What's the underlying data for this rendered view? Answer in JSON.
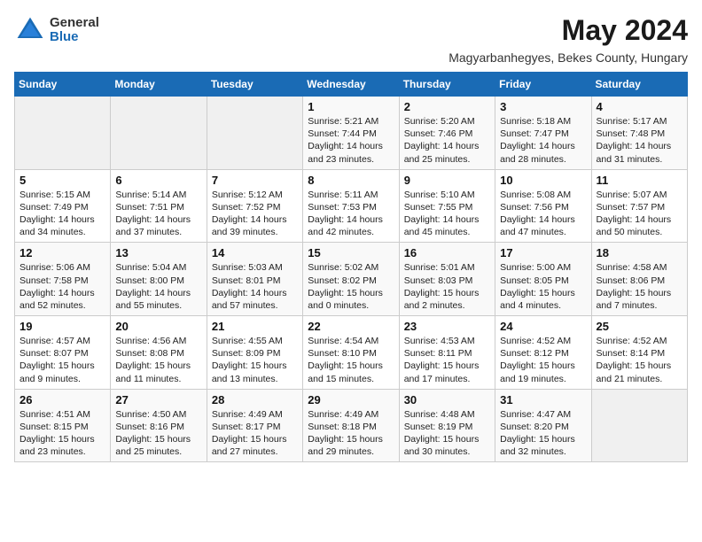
{
  "header": {
    "logo_general": "General",
    "logo_blue": "Blue",
    "month": "May 2024",
    "location": "Magyarbanhegyes, Bekes County, Hungary"
  },
  "weekdays": [
    "Sunday",
    "Monday",
    "Tuesday",
    "Wednesday",
    "Thursday",
    "Friday",
    "Saturday"
  ],
  "weeks": [
    [
      {
        "day": "",
        "info": ""
      },
      {
        "day": "",
        "info": ""
      },
      {
        "day": "",
        "info": ""
      },
      {
        "day": "1",
        "info": "Sunrise: 5:21 AM\nSunset: 7:44 PM\nDaylight: 14 hours\nand 23 minutes."
      },
      {
        "day": "2",
        "info": "Sunrise: 5:20 AM\nSunset: 7:46 PM\nDaylight: 14 hours\nand 25 minutes."
      },
      {
        "day": "3",
        "info": "Sunrise: 5:18 AM\nSunset: 7:47 PM\nDaylight: 14 hours\nand 28 minutes."
      },
      {
        "day": "4",
        "info": "Sunrise: 5:17 AM\nSunset: 7:48 PM\nDaylight: 14 hours\nand 31 minutes."
      }
    ],
    [
      {
        "day": "5",
        "info": "Sunrise: 5:15 AM\nSunset: 7:49 PM\nDaylight: 14 hours\nand 34 minutes."
      },
      {
        "day": "6",
        "info": "Sunrise: 5:14 AM\nSunset: 7:51 PM\nDaylight: 14 hours\nand 37 minutes."
      },
      {
        "day": "7",
        "info": "Sunrise: 5:12 AM\nSunset: 7:52 PM\nDaylight: 14 hours\nand 39 minutes."
      },
      {
        "day": "8",
        "info": "Sunrise: 5:11 AM\nSunset: 7:53 PM\nDaylight: 14 hours\nand 42 minutes."
      },
      {
        "day": "9",
        "info": "Sunrise: 5:10 AM\nSunset: 7:55 PM\nDaylight: 14 hours\nand 45 minutes."
      },
      {
        "day": "10",
        "info": "Sunrise: 5:08 AM\nSunset: 7:56 PM\nDaylight: 14 hours\nand 47 minutes."
      },
      {
        "day": "11",
        "info": "Sunrise: 5:07 AM\nSunset: 7:57 PM\nDaylight: 14 hours\nand 50 minutes."
      }
    ],
    [
      {
        "day": "12",
        "info": "Sunrise: 5:06 AM\nSunset: 7:58 PM\nDaylight: 14 hours\nand 52 minutes."
      },
      {
        "day": "13",
        "info": "Sunrise: 5:04 AM\nSunset: 8:00 PM\nDaylight: 14 hours\nand 55 minutes."
      },
      {
        "day": "14",
        "info": "Sunrise: 5:03 AM\nSunset: 8:01 PM\nDaylight: 14 hours\nand 57 minutes."
      },
      {
        "day": "15",
        "info": "Sunrise: 5:02 AM\nSunset: 8:02 PM\nDaylight: 15 hours\nand 0 minutes."
      },
      {
        "day": "16",
        "info": "Sunrise: 5:01 AM\nSunset: 8:03 PM\nDaylight: 15 hours\nand 2 minutes."
      },
      {
        "day": "17",
        "info": "Sunrise: 5:00 AM\nSunset: 8:05 PM\nDaylight: 15 hours\nand 4 minutes."
      },
      {
        "day": "18",
        "info": "Sunrise: 4:58 AM\nSunset: 8:06 PM\nDaylight: 15 hours\nand 7 minutes."
      }
    ],
    [
      {
        "day": "19",
        "info": "Sunrise: 4:57 AM\nSunset: 8:07 PM\nDaylight: 15 hours\nand 9 minutes."
      },
      {
        "day": "20",
        "info": "Sunrise: 4:56 AM\nSunset: 8:08 PM\nDaylight: 15 hours\nand 11 minutes."
      },
      {
        "day": "21",
        "info": "Sunrise: 4:55 AM\nSunset: 8:09 PM\nDaylight: 15 hours\nand 13 minutes."
      },
      {
        "day": "22",
        "info": "Sunrise: 4:54 AM\nSunset: 8:10 PM\nDaylight: 15 hours\nand 15 minutes."
      },
      {
        "day": "23",
        "info": "Sunrise: 4:53 AM\nSunset: 8:11 PM\nDaylight: 15 hours\nand 17 minutes."
      },
      {
        "day": "24",
        "info": "Sunrise: 4:52 AM\nSunset: 8:12 PM\nDaylight: 15 hours\nand 19 minutes."
      },
      {
        "day": "25",
        "info": "Sunrise: 4:52 AM\nSunset: 8:14 PM\nDaylight: 15 hours\nand 21 minutes."
      }
    ],
    [
      {
        "day": "26",
        "info": "Sunrise: 4:51 AM\nSunset: 8:15 PM\nDaylight: 15 hours\nand 23 minutes."
      },
      {
        "day": "27",
        "info": "Sunrise: 4:50 AM\nSunset: 8:16 PM\nDaylight: 15 hours\nand 25 minutes."
      },
      {
        "day": "28",
        "info": "Sunrise: 4:49 AM\nSunset: 8:17 PM\nDaylight: 15 hours\nand 27 minutes."
      },
      {
        "day": "29",
        "info": "Sunrise: 4:49 AM\nSunset: 8:18 PM\nDaylight: 15 hours\nand 29 minutes."
      },
      {
        "day": "30",
        "info": "Sunrise: 4:48 AM\nSunset: 8:19 PM\nDaylight: 15 hours\nand 30 minutes."
      },
      {
        "day": "31",
        "info": "Sunrise: 4:47 AM\nSunset: 8:20 PM\nDaylight: 15 hours\nand 32 minutes."
      },
      {
        "day": "",
        "info": ""
      }
    ]
  ]
}
